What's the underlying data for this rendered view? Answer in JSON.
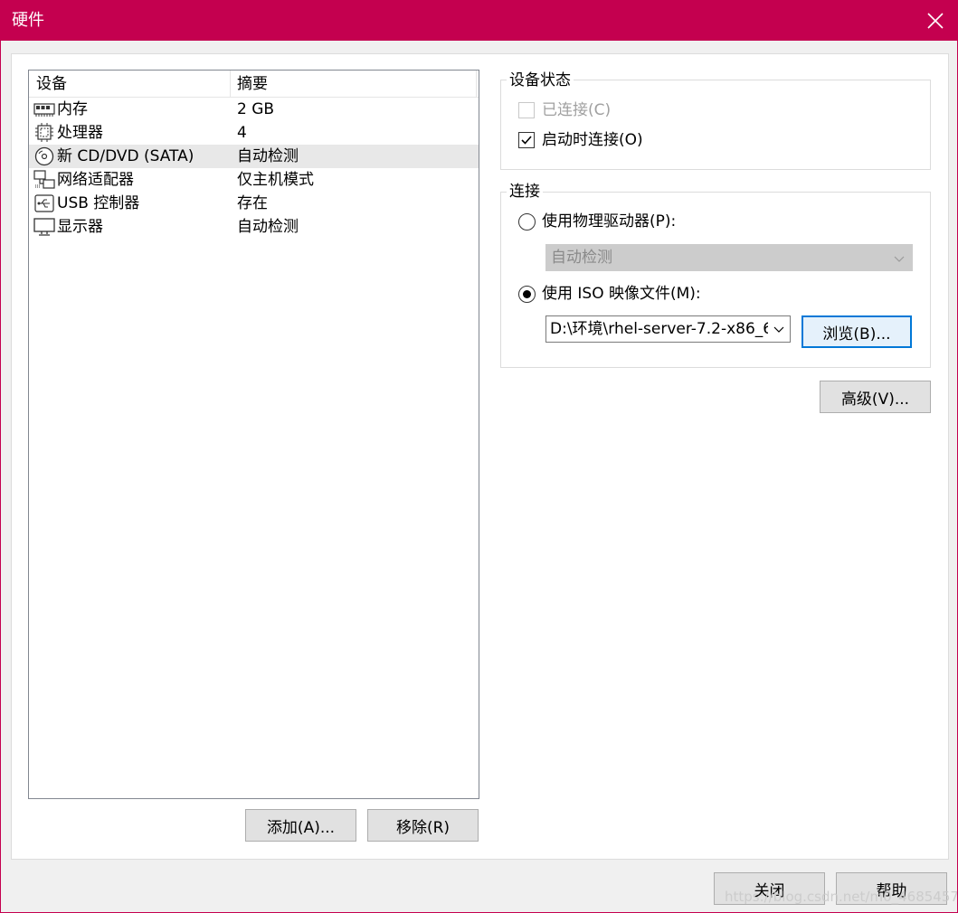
{
  "window": {
    "title": "硬件"
  },
  "device_list": {
    "columns": [
      "设备",
      "摘要"
    ],
    "rows": [
      {
        "name": "内存",
        "summary": "2 GB",
        "icon": "memory-icon"
      },
      {
        "name": "处理器",
        "summary": "4",
        "icon": "processor-icon"
      },
      {
        "name": "新 CD/DVD (SATA)",
        "summary": "自动检测",
        "icon": "cd-dvd-icon",
        "selected": true
      },
      {
        "name": "网络适配器",
        "summary": "仅主机模式",
        "icon": "network-adapter-icon"
      },
      {
        "name": "USB 控制器",
        "summary": "存在",
        "icon": "usb-icon"
      },
      {
        "name": "显示器",
        "summary": "自动检测",
        "icon": "monitor-icon"
      }
    ],
    "add_button": "添加(A)...",
    "remove_button": "移除(R)"
  },
  "device_status": {
    "label": "设备状态",
    "connected": {
      "label": "已连接(C)",
      "checked": false,
      "disabled": true
    },
    "connect_at_power_on": {
      "label": "启动时连接(O)",
      "checked": true
    }
  },
  "connection": {
    "label": "连接",
    "physical_drive": {
      "label": "使用物理驱动器(P):",
      "selected": false,
      "value": "自动检测"
    },
    "iso_image": {
      "label": "使用 ISO 映像文件(M):",
      "selected": true,
      "value": "D:\\环境\\rhel-server-7.2-x86_6"
    },
    "browse_button": "浏览(B)..."
  },
  "advanced_button": "高级(V)...",
  "footer": {
    "close_button": "关闭",
    "help_button": "帮助"
  },
  "watermark": "https://blog.csdn.net/m0_46854572"
}
